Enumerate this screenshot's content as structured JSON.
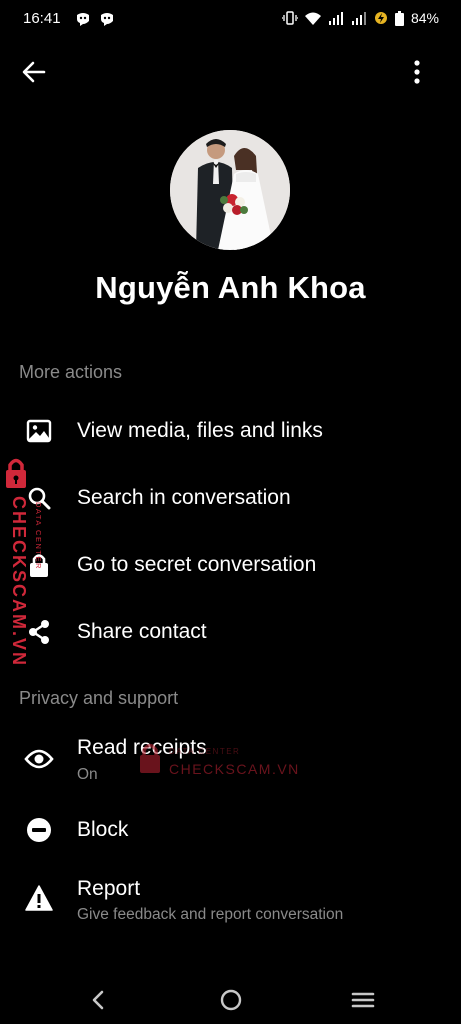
{
  "status_bar": {
    "time": "16:41",
    "battery": "84%"
  },
  "app_bar": {
    "back_icon": "arrow-left-icon",
    "more_icon": "more-vert-icon"
  },
  "profile": {
    "name": "Nguyễn Anh Khoa"
  },
  "more_actions": {
    "title": "More actions",
    "items": [
      {
        "label": "View media, files and links",
        "icon": "image-icon"
      },
      {
        "label": "Search in conversation",
        "icon": "search-icon"
      },
      {
        "label": "Go to secret conversation",
        "icon": "lock-icon"
      },
      {
        "label": "Share contact",
        "icon": "share-icon"
      }
    ]
  },
  "privacy_support": {
    "title": "Privacy and support",
    "items": [
      {
        "label": "Read receipts",
        "sub": "On",
        "icon": "eye-icon"
      },
      {
        "label": "Block",
        "icon": "block-icon"
      },
      {
        "label": "Report",
        "sub": "Give feedback and report conversation",
        "icon": "warning-icon"
      }
    ]
  },
  "watermark": {
    "brand": "CHECKSCAM.VN",
    "tagline": "DATA CENTER",
    "color": "#d0283a"
  },
  "colors": {
    "background": "#000000",
    "secondary_text": "#8a8a8a"
  }
}
